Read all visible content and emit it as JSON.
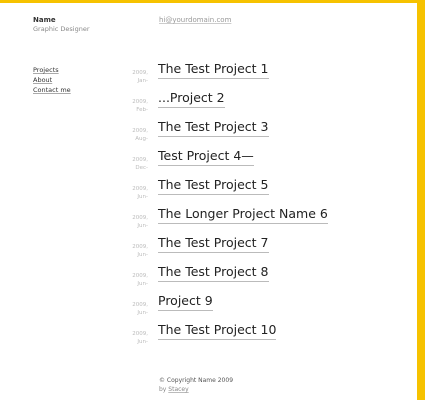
{
  "header": {
    "name": "Name",
    "tagline": "Graphic Designer",
    "email": "hi@yourdomain.com"
  },
  "nav": {
    "items": [
      "Projects",
      "About",
      "Contact me"
    ]
  },
  "projects": [
    {
      "title": "The Test Project 1",
      "year": "2009,",
      "month": "Jan-"
    },
    {
      "title": "...Project 2",
      "year": "2009,",
      "month": "Feb-"
    },
    {
      "title": "The Test Project 3",
      "year": "2009,",
      "month": "Aug-"
    },
    {
      "title": "Test Project 4—",
      "year": "2009,",
      "month": "Dec-"
    },
    {
      "title": "The Test Project 5",
      "year": "2009,",
      "month": "Jun-"
    },
    {
      "title": "The Longer Project Name 6",
      "year": "2009,",
      "month": "Jun-"
    },
    {
      "title": "The Test Project 7",
      "year": "2009,",
      "month": "Jun-"
    },
    {
      "title": "The Test Project 8",
      "year": "2009,",
      "month": "Jun-"
    },
    {
      "title": "Project 9",
      "year": "2009,",
      "month": "Jun-"
    },
    {
      "title": "The Test Project 10",
      "year": "2009,",
      "month": "Jun-"
    }
  ],
  "footer": {
    "copyright": "© Copyright Name 2009",
    "by": "by",
    "credit": "Stacey"
  }
}
